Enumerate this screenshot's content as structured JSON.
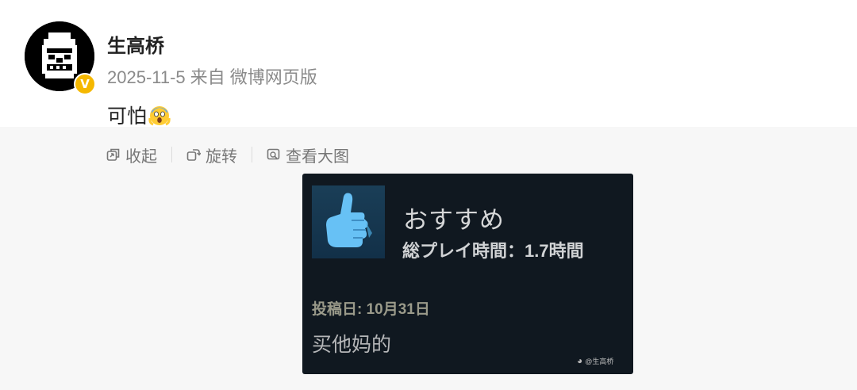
{
  "post": {
    "author": "生高桥",
    "date": "2025-11-5",
    "source": "来自 微博网页版",
    "text": "可怕",
    "emoji": "scream-emoji",
    "verified_badge": "V"
  },
  "toolbar": {
    "collapse_label": "收起",
    "rotate_label": "旋转",
    "view_large_label": "查看大图"
  },
  "review_image": {
    "recommendation": "おすすめ",
    "playtime": "総プレイ時間：1.7時間",
    "posted": "投稿日: 10月31日",
    "review_text": "买他妈的",
    "watermark": "@生高桥",
    "thumb_icon": "thumbs-up-icon"
  },
  "colors": {
    "panel_bg": "#f7f7f7",
    "review_bg": "#101820",
    "verified": "#f5b800",
    "thumb": "#67c1f5"
  }
}
